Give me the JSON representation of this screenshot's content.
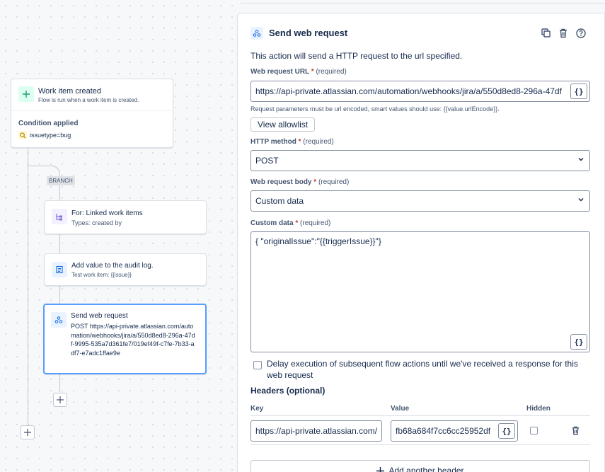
{
  "flow": {
    "trigger_title": "Work item created",
    "trigger_sub": "Flow is run when a work item is created.",
    "condition_title": "Condition applied",
    "condition_value": "issuetype=bug",
    "branch_label": "BRANCH",
    "for_title": "For: Linked work items",
    "for_sub": "Types: created by",
    "audit_title": "Add value to the audit log.",
    "audit_sub": "Test work item: {{issue}}",
    "web_title": "Send web request",
    "web_sub": "POST https://api-private.atlassian.com/automation/webhooks/jira/a/550d8ed8-296a-47df-9995-535a7d361fe7/019ef49f-c7fe-7b33-adf7-e7adc1ffae9e"
  },
  "panel": {
    "title": "Send web request",
    "description": "This action will send a HTTP request to the url specified.",
    "url_label": "Web request URL",
    "required_text": "(required)",
    "url_value": "https://api-private.atlassian.com/automation/webhooks/jira/a/550d8ed8-296a-47df",
    "url_help": "Request parameters must be url encoded, smart values should use: {{value.urlEncode}}.",
    "allowlist_button": "View allowlist",
    "method_label": "HTTP method",
    "method_value": "POST",
    "body_label": "Web request body",
    "body_value": "Custom data",
    "custom_label": "Custom data",
    "custom_value": "{ \"originalIssue\":\"{{triggerIssue}}\"}",
    "delay_text": "Delay execution of subsequent flow actions until we've received a response for this web request",
    "headers_title": "Headers (optional)",
    "col_key": "Key",
    "col_value": "Value",
    "col_hidden": "Hidden",
    "header_key": "https://api-private.atlassian.com/",
    "header_value": "fb68a684f7cc6cc25952df",
    "add_header": "Add another header",
    "braces": "{}",
    "required_marker": "*"
  },
  "colors": {
    "accent": "#0c66e4",
    "required": "#c9372c",
    "trigger_icon": "#22a06b",
    "condition_icon": "#b38600",
    "audit_icon": "#0c66e4",
    "web_icon": "#0c66e4"
  }
}
